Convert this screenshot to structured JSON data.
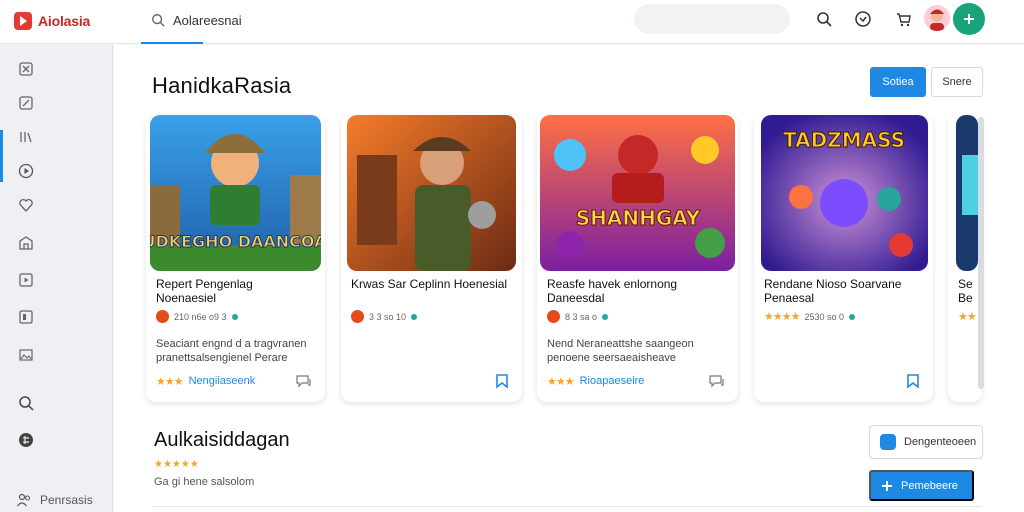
{
  "app": {
    "name": "Aiolasia"
  },
  "search": {
    "placeholder": "",
    "value": "Aolareesnai"
  },
  "main": {
    "title": "HanidkaRasia",
    "primary_button": "Sotiea",
    "secondary_button": "Snere"
  },
  "cards": [
    {
      "title": "Repert Pengenlag Noenaesiel",
      "meta": "210 n6e o9 3",
      "desc": "Seaciant engnd d a tragvranen pranettsalsengienel Perare",
      "link": "Nengiiaseenk",
      "rating": 3,
      "bookmark": false,
      "art_text": "BUDKEGHO DAANCOAD"
    },
    {
      "title": "Krwas Sar Ceplinn Hoenesial",
      "meta": "3 3 so 10",
      "desc": "",
      "link": "",
      "rating": 0,
      "bookmark": true,
      "art_text": ""
    },
    {
      "title": "Reasfe havek enlornong Daneesdal",
      "meta": "8 3 sa o",
      "desc": "Nend Neraneattshe saangeon penoene seersaeaisheave",
      "link": "Rioapaeseire",
      "rating": 3,
      "bookmark": false,
      "art_text": "SHANHGAY"
    },
    {
      "title": "Rendane Nioso Soarvane Penaesal",
      "meta": "2530 so 0",
      "desc": "",
      "link": "",
      "rating": 4,
      "bookmark": true,
      "art_text": "TADZMASS"
    },
    {
      "title": "Se Be",
      "meta": "",
      "desc": "",
      "link": "",
      "rating": 2,
      "bookmark": false,
      "art_text": ""
    }
  ],
  "section2": {
    "title": "Aulkaisiddagan",
    "rating": 5,
    "subtitle": "Ga gi hene salsolom",
    "outline_button": "Dengenteoeen",
    "primary_button": "Pemebeere"
  },
  "sidebar": {
    "footer_label": "Penrsasis"
  },
  "colors": {
    "accent": "#1e88e5",
    "brand": "#e53935",
    "fab": "#1aa37a",
    "star": "#f5a623"
  }
}
